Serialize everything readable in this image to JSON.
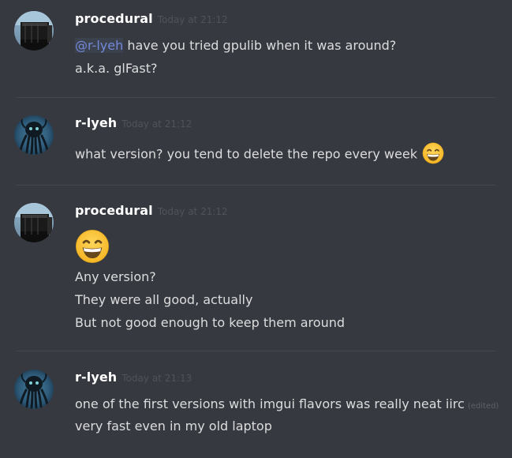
{
  "messages": [
    {
      "author": "procedural",
      "timestamp": "Today at 21:12",
      "lines": {
        "l0_mention": "@r-lyeh",
        "l0_text": " have you tried gpulib when it was around?",
        "l1": "a.k.a. glFast?"
      }
    },
    {
      "author": "r-lyeh",
      "timestamp": "Today at 21:12",
      "lines": {
        "l0": "what version? you tend to delete the repo every week"
      },
      "emoji": "grinning-smile-emoji"
    },
    {
      "author": "procedural",
      "timestamp": "Today at 21:12",
      "emoji": "grinning-smile-emoji",
      "lines": {
        "l0": "Any version?",
        "l1": "They were all good, actually",
        "l2": "But not good enough to keep them around"
      }
    },
    {
      "author": "r-lyeh",
      "timestamp": "Today at 21:13",
      "lines": {
        "l0": "one of the first versions with imgui flavors was really neat iirc",
        "l0_edited": "(edited)",
        "l1": "very fast even in my old laptop"
      }
    }
  ],
  "colors": {
    "background": "#36393f",
    "username": "#ffffff",
    "text": "#dcddde",
    "timestamp": "#4f535a",
    "mention": "#7289da",
    "divider": "#42454a"
  }
}
